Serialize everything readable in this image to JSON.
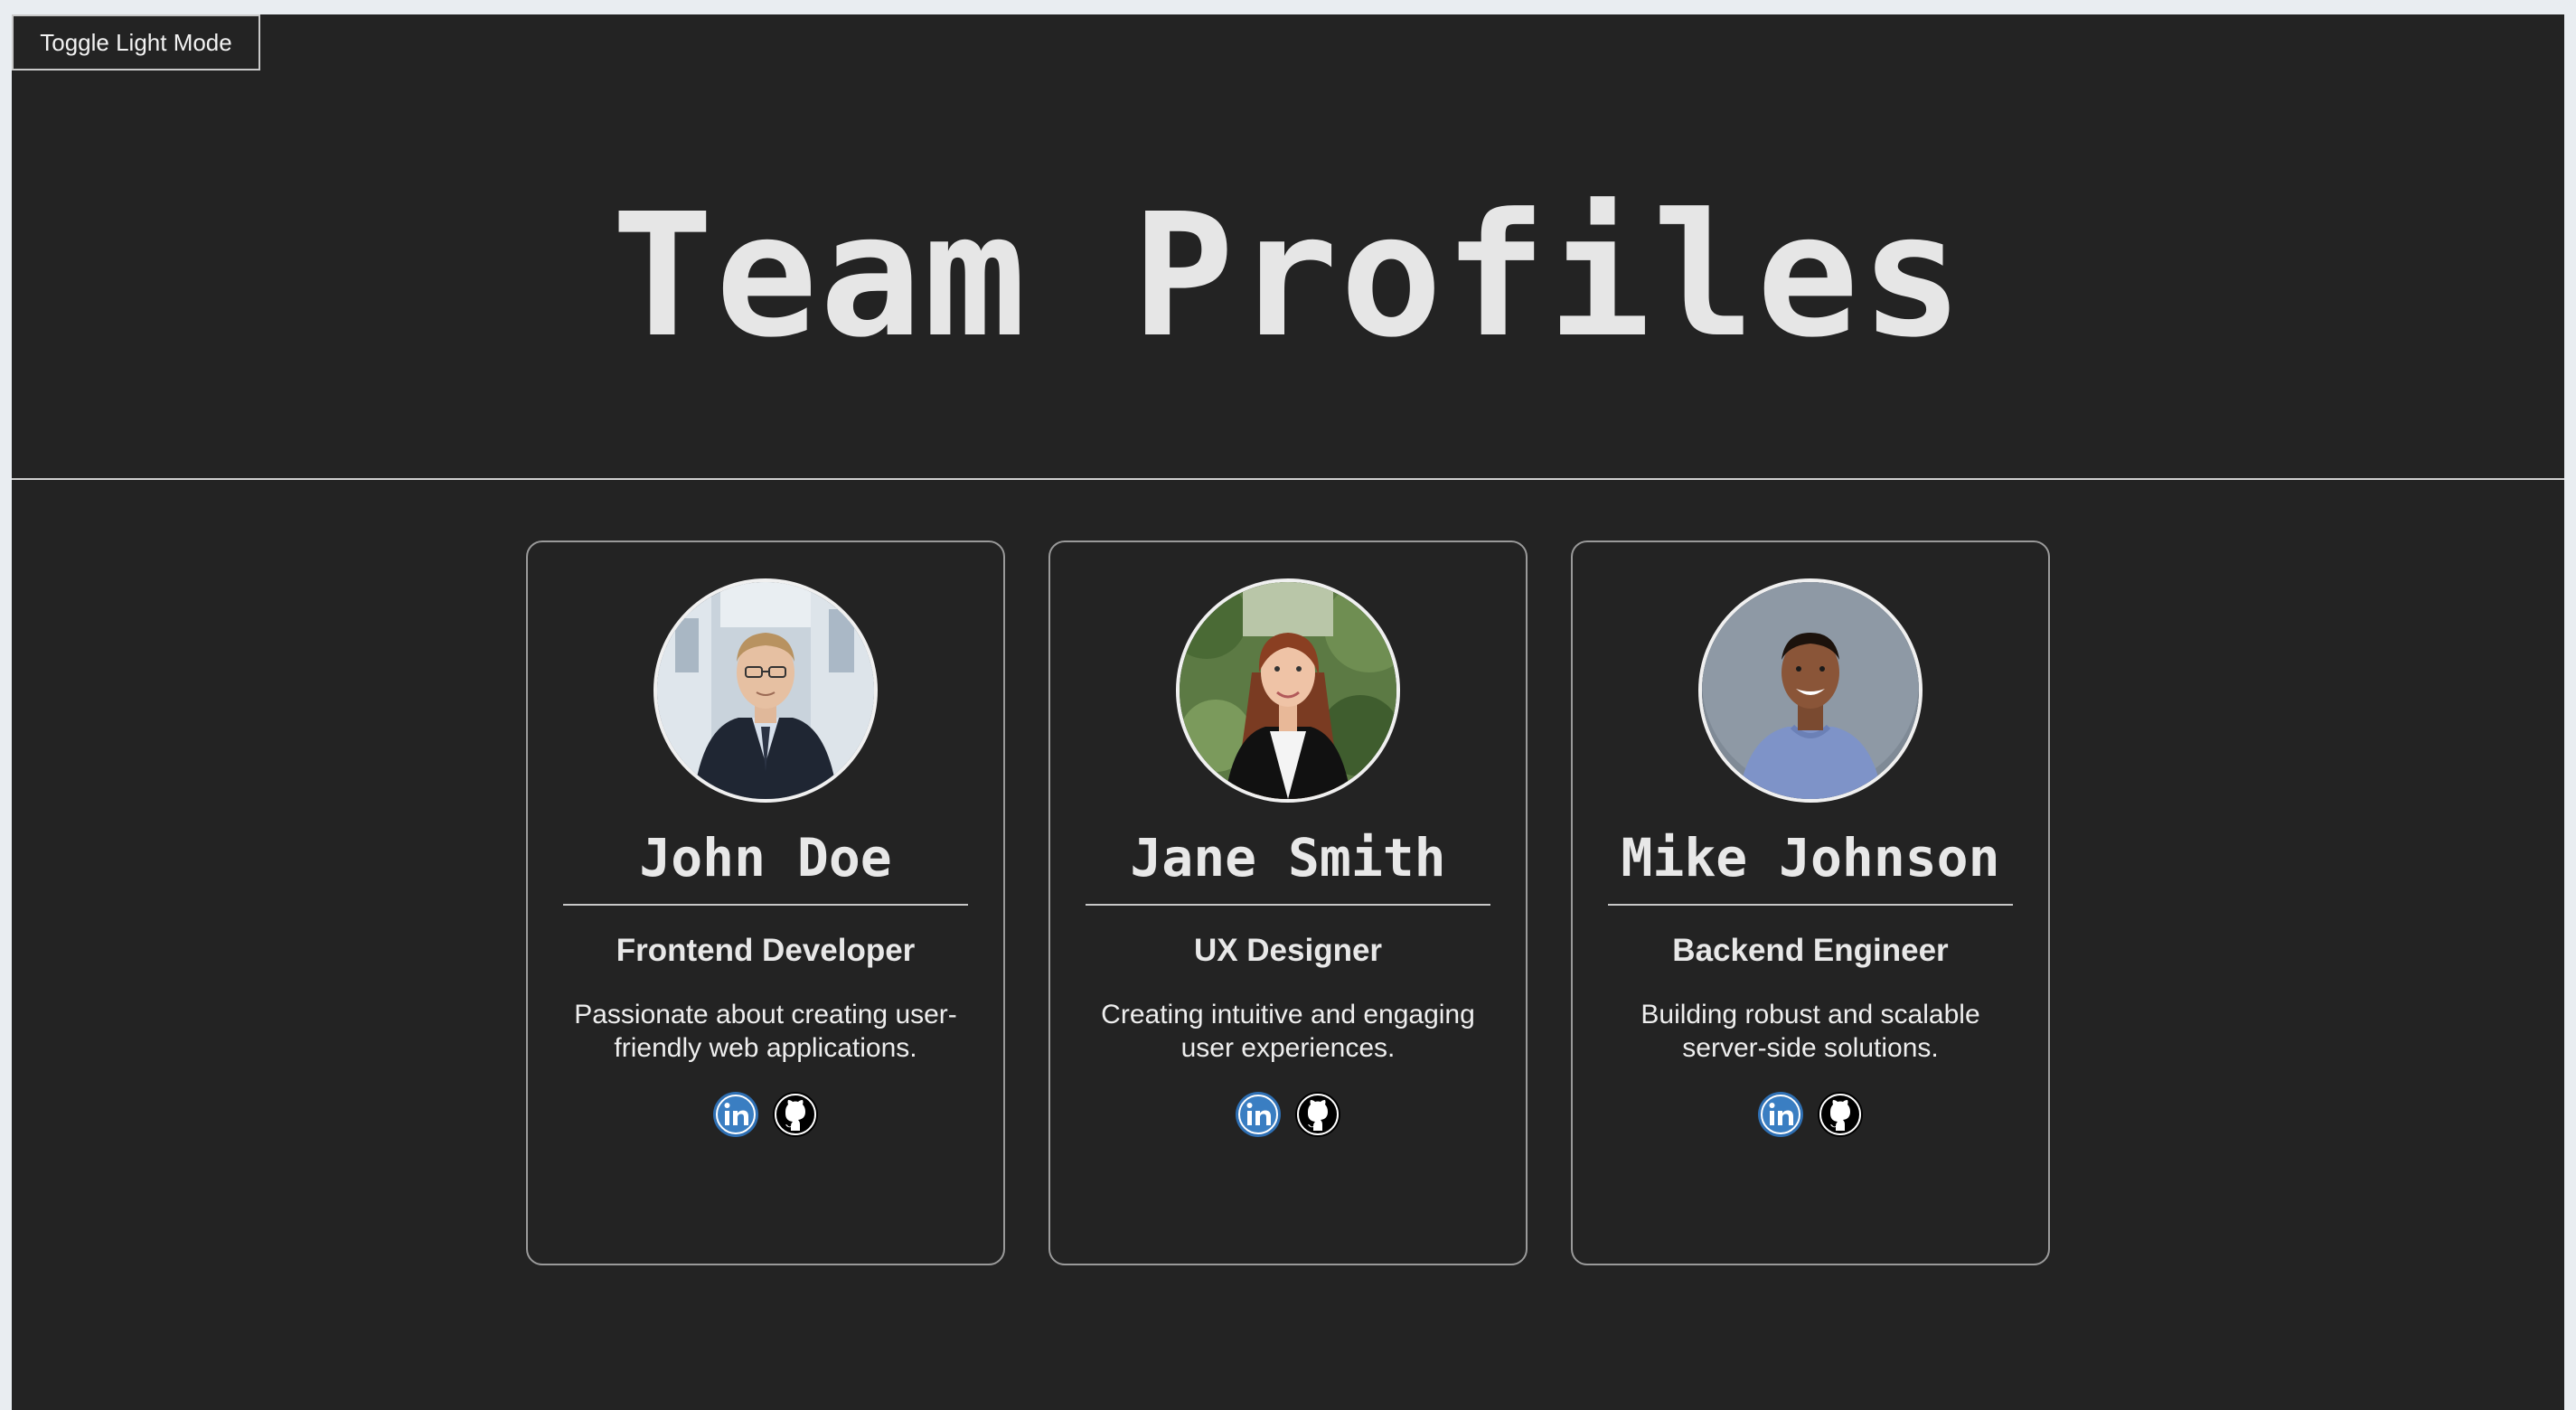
{
  "toggle": {
    "label": "Toggle Light Mode"
  },
  "header": {
    "title": "Team Profiles"
  },
  "colors": {
    "background": "#232323",
    "text": "#e6e6e6",
    "linkedin": "#2e6fb3",
    "github": "#000000"
  },
  "members": [
    {
      "name": "John Doe",
      "role": "Frontend Developer",
      "bio": "Passionate about creating user-friendly web applications.",
      "avatar_icon": "man-in-suit-photo",
      "social": [
        "linkedin-icon",
        "github-icon"
      ]
    },
    {
      "name": "Jane Smith",
      "role": "UX Designer",
      "bio": "Creating intuitive and engaging user experiences.",
      "avatar_icon": "woman-in-blazer-photo",
      "social": [
        "linkedin-icon",
        "github-icon"
      ]
    },
    {
      "name": "Mike Johnson",
      "role": "Backend Engineer",
      "bio": "Building robust and scalable server-side solutions.",
      "avatar_icon": "man-in-tshirt-photo",
      "social": [
        "linkedin-icon",
        "github-icon"
      ]
    }
  ]
}
